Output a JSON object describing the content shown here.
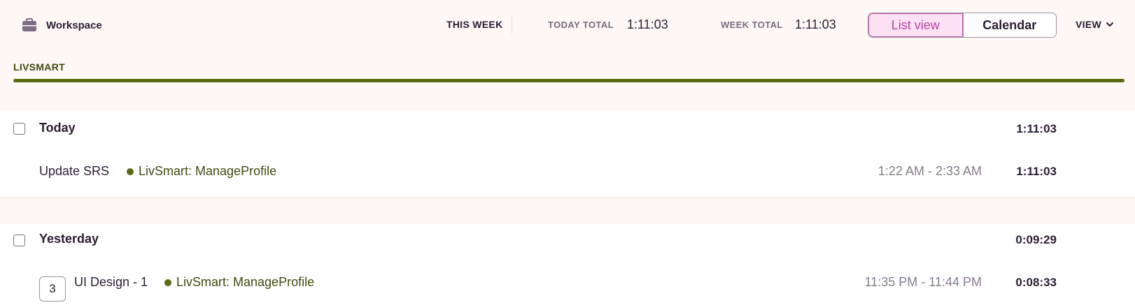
{
  "header": {
    "workspace_label": "Workspace",
    "this_week_label": "THIS WEEK",
    "today_total_label": "TODAY TOTAL",
    "today_total_value": "1:11:03",
    "week_total_label": "WEEK TOTAL",
    "week_total_value": "1:11:03",
    "view_toggle": {
      "list_label": "List view",
      "calendar_label": "Calendar",
      "active": "List view"
    },
    "view_menu_label": "VIEW"
  },
  "project": {
    "name": "LIVSMART",
    "color": "#5a6b14"
  },
  "groups": [
    {
      "title": "Today",
      "total": "1:11:03",
      "entries": [
        {
          "description": "Update SRS",
          "project": "LivSmart: ManageProfile",
          "time_range": "1:22 AM - 2:33 AM",
          "duration": "1:11:03"
        }
      ]
    },
    {
      "title": "Yesterday",
      "total": "0:09:29",
      "entries": [
        {
          "count": "3",
          "description": "UI Design - 1",
          "project": "LivSmart: ManageProfile",
          "time_range": "11:35 PM - 11:44 PM",
          "duration": "0:08:33"
        }
      ]
    }
  ],
  "colors": {
    "accent_pink": "#b5449b",
    "project_green": "#5a6b14",
    "background": "#fdf7f5"
  }
}
